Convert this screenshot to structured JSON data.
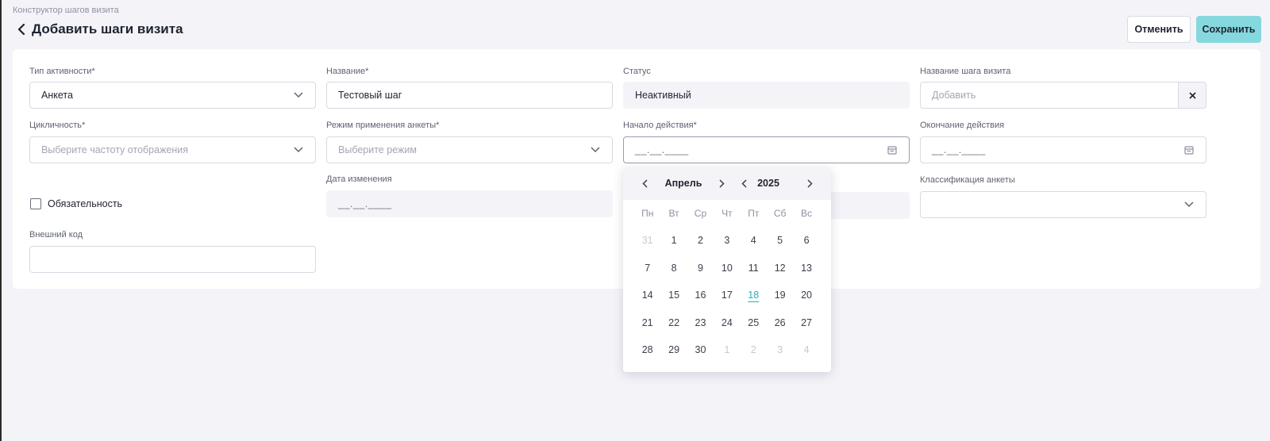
{
  "breadcrumb": "Конструктор шагов визита",
  "page_title": "Добавить шаги визита",
  "buttons": {
    "cancel": "Отменить",
    "save": "Сохранить"
  },
  "form": {
    "activity_type": {
      "label": "Тип активности*",
      "value": "Анкета"
    },
    "name": {
      "label": "Название*",
      "value": "Тестовый шаг"
    },
    "status": {
      "label": "Статус",
      "value": "Неактивный"
    },
    "step_name": {
      "label": "Название шага визита",
      "placeholder": "Добавить"
    },
    "cyclicity": {
      "label": "Цикличность*",
      "placeholder": "Выберите частоту отображения"
    },
    "apply_mode": {
      "label": "Режим применения анкеты*",
      "placeholder": "Выберите режим"
    },
    "start_date": {
      "label": "Начало действия*",
      "mask": "__.__.____"
    },
    "end_date": {
      "label": "Окончание действия",
      "mask": "__.__.____"
    },
    "change_date": {
      "label": "Дата изменения",
      "mask": "__.__.____"
    },
    "classification": {
      "label": "Классификация анкеты",
      "value": ""
    },
    "mandatory": {
      "label": "Обязательность",
      "checked": false
    },
    "external_code": {
      "label": "Внешний код",
      "value": ""
    }
  },
  "calendar": {
    "month": "Апрель",
    "year": "2025",
    "weekdays": [
      "Пн",
      "Вт",
      "Ср",
      "Чт",
      "Пт",
      "Сб",
      "Вс"
    ],
    "weeks": [
      [
        "31",
        "1",
        "2",
        "3",
        "4",
        "5",
        "6"
      ],
      [
        "7",
        "8",
        "9",
        "10",
        "11",
        "12",
        "13"
      ],
      [
        "14",
        "15",
        "16",
        "17",
        "18",
        "19",
        "20"
      ],
      [
        "21",
        "22",
        "23",
        "24",
        "25",
        "26",
        "27"
      ],
      [
        "28",
        "29",
        "30",
        "1",
        "2",
        "3",
        "4"
      ]
    ],
    "muted_cells": [
      [
        0,
        0
      ],
      [
        4,
        3
      ],
      [
        4,
        4
      ],
      [
        4,
        5
      ],
      [
        4,
        6
      ]
    ],
    "today_cell": [
      2,
      4
    ],
    "today_color": "#26b0ba"
  },
  "colors": {
    "accent": "#86d8df",
    "background": "#f4f4f8"
  }
}
